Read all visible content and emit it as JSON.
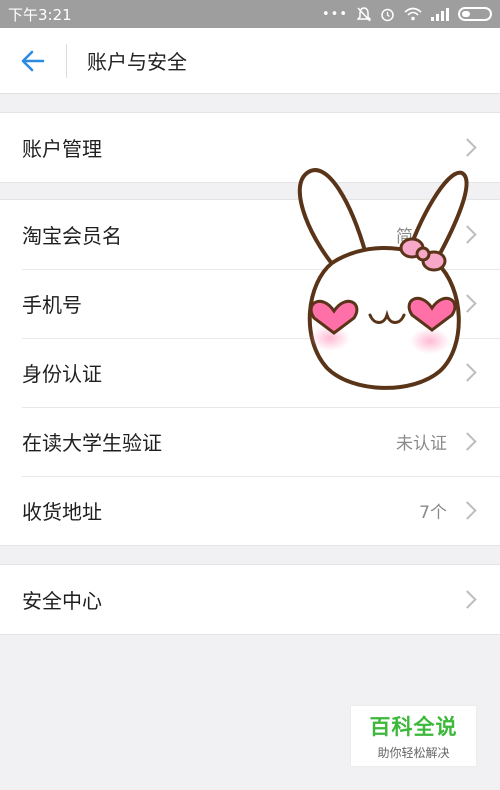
{
  "status_bar": {
    "time": "下午3:21",
    "dots": "•••"
  },
  "header": {
    "title": "账户与安全"
  },
  "groups": [
    {
      "rows": [
        {
          "label": "账户管理",
          "value": ""
        }
      ]
    },
    {
      "rows": [
        {
          "label": "淘宝会员名",
          "value": "简单快"
        },
        {
          "label": "手机号",
          "value": ""
        },
        {
          "label": "身份认证",
          "value": ""
        },
        {
          "label": "在读大学生验证",
          "value": "未认证"
        },
        {
          "label": "收货地址",
          "value": "7个"
        }
      ]
    },
    {
      "rows": [
        {
          "label": "安全中心",
          "value": ""
        }
      ]
    }
  ],
  "watermark": {
    "title": "百科全说",
    "subtitle": "助你轻松解决"
  },
  "colors": {
    "accent": "#2b8ae2",
    "watermark": "#3cb83a",
    "heart": "#ff6fa8"
  },
  "icons": [
    "back-arrow-icon",
    "chevron-right-icon",
    "wifi-icon",
    "signal-icon",
    "battery-icon",
    "alarm-icon",
    "mute-icon",
    "bunny-sticker"
  ]
}
